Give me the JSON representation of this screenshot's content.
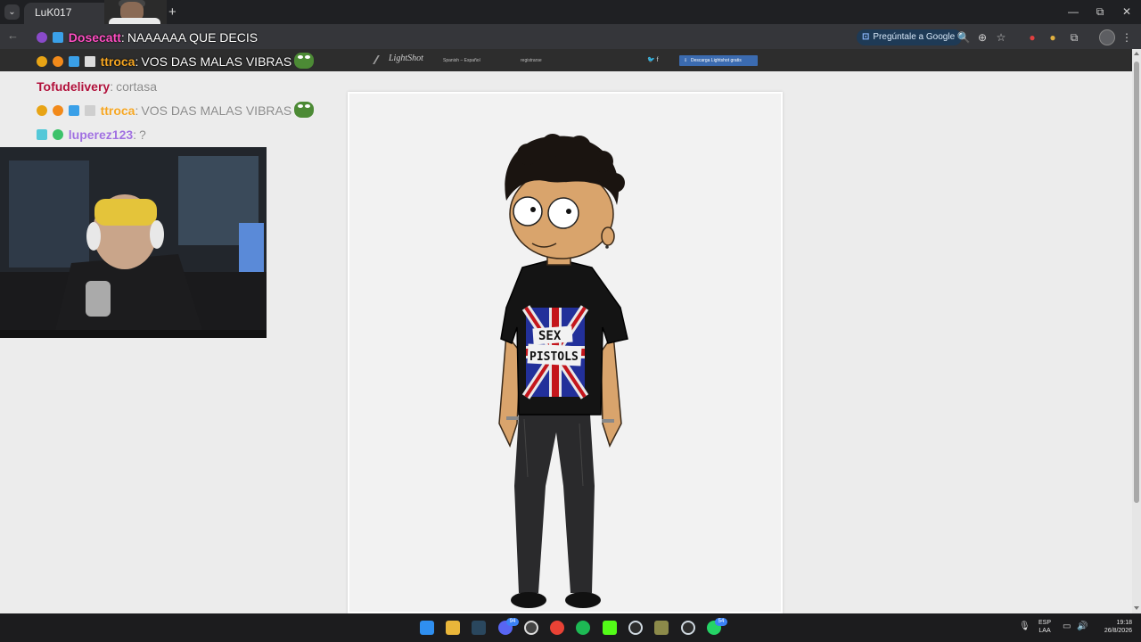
{
  "browser": {
    "tab": {
      "title": "LuK017"
    },
    "new_tab_label": "+",
    "window_controls": {
      "minimize": "—",
      "restore": "⧉",
      "close": "✕"
    },
    "toolbar": {
      "back_label": "←",
      "google_pill_label": "Pregúntale a Google",
      "zoom_icon": "🔍",
      "install_icon": "⊕",
      "star_icon": "☆",
      "extensions_icon": "⧉",
      "menu_icon": "⋮"
    }
  },
  "lightshot": {
    "logo": "LightShot",
    "language": "Spanish – Español",
    "register": "registrarse",
    "social": "🐦  f",
    "download_label": "Descarga Lightshot gratis"
  },
  "chat": [
    {
      "user": "Dosecatt",
      "separator": ":",
      "message": "NAAAAAA QUE DECIS",
      "user_color": "#ff4fc3",
      "theme": "dark"
    },
    {
      "user": "ttroca",
      "separator": ":",
      "message": "VOS DAS MALAS VIBRAS",
      "user_color": "#f5a623",
      "theme": "dark"
    },
    {
      "user": "Tofudelivery",
      "separator": ":",
      "message": "cortasa",
      "user_color": "#b0103a",
      "theme": "light"
    },
    {
      "user": "ttroca",
      "separator": ":",
      "message": "VOS DAS MALAS VIBRAS",
      "user_color": "#f5a623",
      "theme": "light"
    },
    {
      "user": "luperez123",
      "separator": ":",
      "message": "?",
      "user_color": "#a070e0",
      "theme": "light"
    }
  ],
  "image": {
    "shirt_text": [
      "SEX",
      "PISTOLS"
    ]
  },
  "taskbar": {
    "badges": {
      "discord": "94",
      "whatsapp": "54"
    },
    "language": [
      "ESP",
      "LAA"
    ],
    "time": "19:18",
    "date": "26/8/2026"
  },
  "colors": {
    "tabstrip": "#1f2023",
    "toolbar": "#35363a",
    "page_background": "#ececec",
    "taskbar": "#1c1c1e"
  }
}
